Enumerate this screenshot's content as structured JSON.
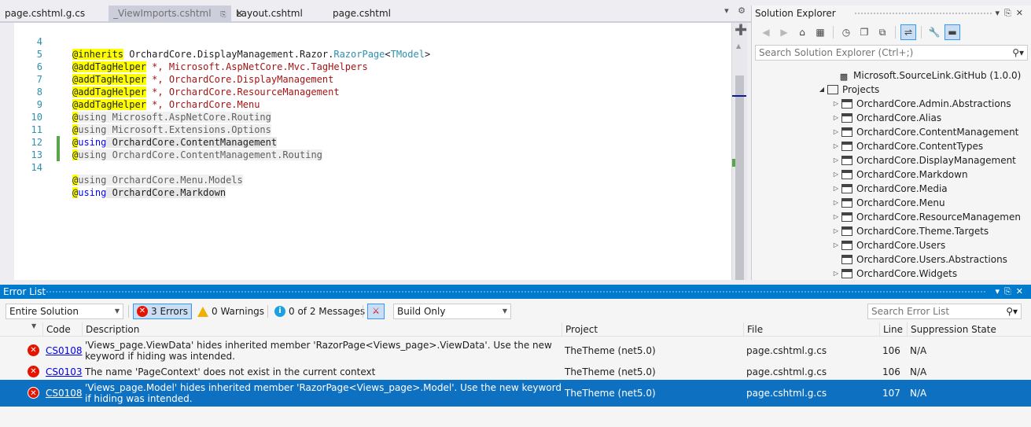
{
  "editor": {
    "tabs": [
      {
        "label": "page.cshtml.g.cs"
      },
      {
        "label": "_ViewImports.cshtml"
      },
      {
        "label": "Layout.cshtml"
      },
      {
        "label": "page.cshtml"
      }
    ],
    "lines": [
      {
        "num": "4",
        "directive": "@inherits",
        "text": " OrchardCore.DisplayManagement.Razor.",
        "type": "RazorPage",
        "lt": "<",
        "tparam": "TModel",
        "gt": ">"
      },
      {
        "num": "5",
        "directive": "@addTagHelper",
        "text": " *, Microsoft.AspNetCore.Mvc.TagHelpers"
      },
      {
        "num": "6",
        "directive": "@addTagHelper",
        "text": " *, OrchardCore.DisplayManagement"
      },
      {
        "num": "7",
        "directive": "@addTagHelper",
        "text": " *, OrchardCore.ResourceManagement"
      },
      {
        "num": "8",
        "directive": "@addTagHelper",
        "text": " *, OrchardCore.Menu"
      },
      {
        "num": "9",
        "at": "@",
        "kw": "using",
        "text": " Microsoft.AspNetCore.Routing"
      },
      {
        "num": "10",
        "at": "@",
        "kw": "using",
        "text": " Microsoft.Extensions.Options"
      },
      {
        "num": "11",
        "at": "@",
        "kw": "using",
        "text": " OrchardCore.ContentManagement"
      },
      {
        "num": "12",
        "at": "@",
        "kw": "using",
        "text": " OrchardCore.ContentManagement.Routing"
      },
      {
        "num": "13",
        "at": "@",
        "kw": "using",
        "text": " OrchardCore.Menu.Models"
      },
      {
        "num": "14",
        "at": "@",
        "kw": "using",
        "text": " OrchardCore.Markdown"
      }
    ]
  },
  "solution_explorer": {
    "title": "Solution Explorer",
    "search_placeholder": "Search Solution Explorer (Ctrl+;)",
    "tree": [
      {
        "label": "Microsoft.SourceLink.GitHub (1.0.0)",
        "kind": "package"
      },
      {
        "label": "Projects",
        "kind": "folder"
      },
      {
        "label": "OrchardCore.Admin.Abstractions",
        "kind": "project"
      },
      {
        "label": "OrchardCore.Alias",
        "kind": "project"
      },
      {
        "label": "OrchardCore.ContentManagement",
        "kind": "project"
      },
      {
        "label": "OrchardCore.ContentTypes",
        "kind": "project"
      },
      {
        "label": "OrchardCore.DisplayManagement",
        "kind": "project"
      },
      {
        "label": "OrchardCore.Markdown",
        "kind": "project"
      },
      {
        "label": "OrchardCore.Media",
        "kind": "project"
      },
      {
        "label": "OrchardCore.Menu",
        "kind": "project"
      },
      {
        "label": "OrchardCore.ResourceManagemen",
        "kind": "project"
      },
      {
        "label": "OrchardCore.Theme.Targets",
        "kind": "project"
      },
      {
        "label": "OrchardCore.Users",
        "kind": "project"
      },
      {
        "label": "OrchardCore.Users.Abstractions",
        "kind": "project"
      },
      {
        "label": "OrchardCore.Widgets",
        "kind": "project"
      }
    ]
  },
  "error_list": {
    "title": "Error List",
    "scope": "Entire Solution",
    "errors_label": "3 Errors",
    "warnings_label": "0 Warnings",
    "messages_label": "0 of 2 Messages",
    "build_filter": "Build Only",
    "search_placeholder": "Search Error List",
    "columns": [
      "Code",
      "Description",
      "Project",
      "File",
      "Line",
      "Suppression State"
    ],
    "rows": [
      {
        "code": "CS0108",
        "description": "'Views_page.ViewData' hides inherited member 'RazorPage<Views_page>.ViewData'. Use the new keyword if hiding was intended.",
        "project": "TheTheme (net5.0)",
        "file": "page.cshtml.g.cs",
        "line": "106",
        "suppression": "N/A"
      },
      {
        "code": "CS0103",
        "description": "The name 'PageContext' does not exist in the current context",
        "project": "TheTheme (net5.0)",
        "file": "page.cshtml.g.cs",
        "line": "106",
        "suppression": "N/A"
      },
      {
        "code": "CS0108",
        "description": "'Views_page.Model' hides inherited member 'RazorPage<Views_page>.Model'. Use the new keyword if hiding was intended.",
        "project": "TheTheme (net5.0)",
        "file": "page.cshtml.g.cs",
        "line": "107",
        "suppression": "N/A"
      }
    ]
  },
  "icons": {
    "error": "error-icon",
    "warning": "warning-icon",
    "info": "info-icon",
    "search": "search-icon"
  },
  "colors": {
    "accent": "#007acc",
    "selection": "#0e70c0",
    "error": "#e51400",
    "directive_highlight": "#ffff00"
  }
}
